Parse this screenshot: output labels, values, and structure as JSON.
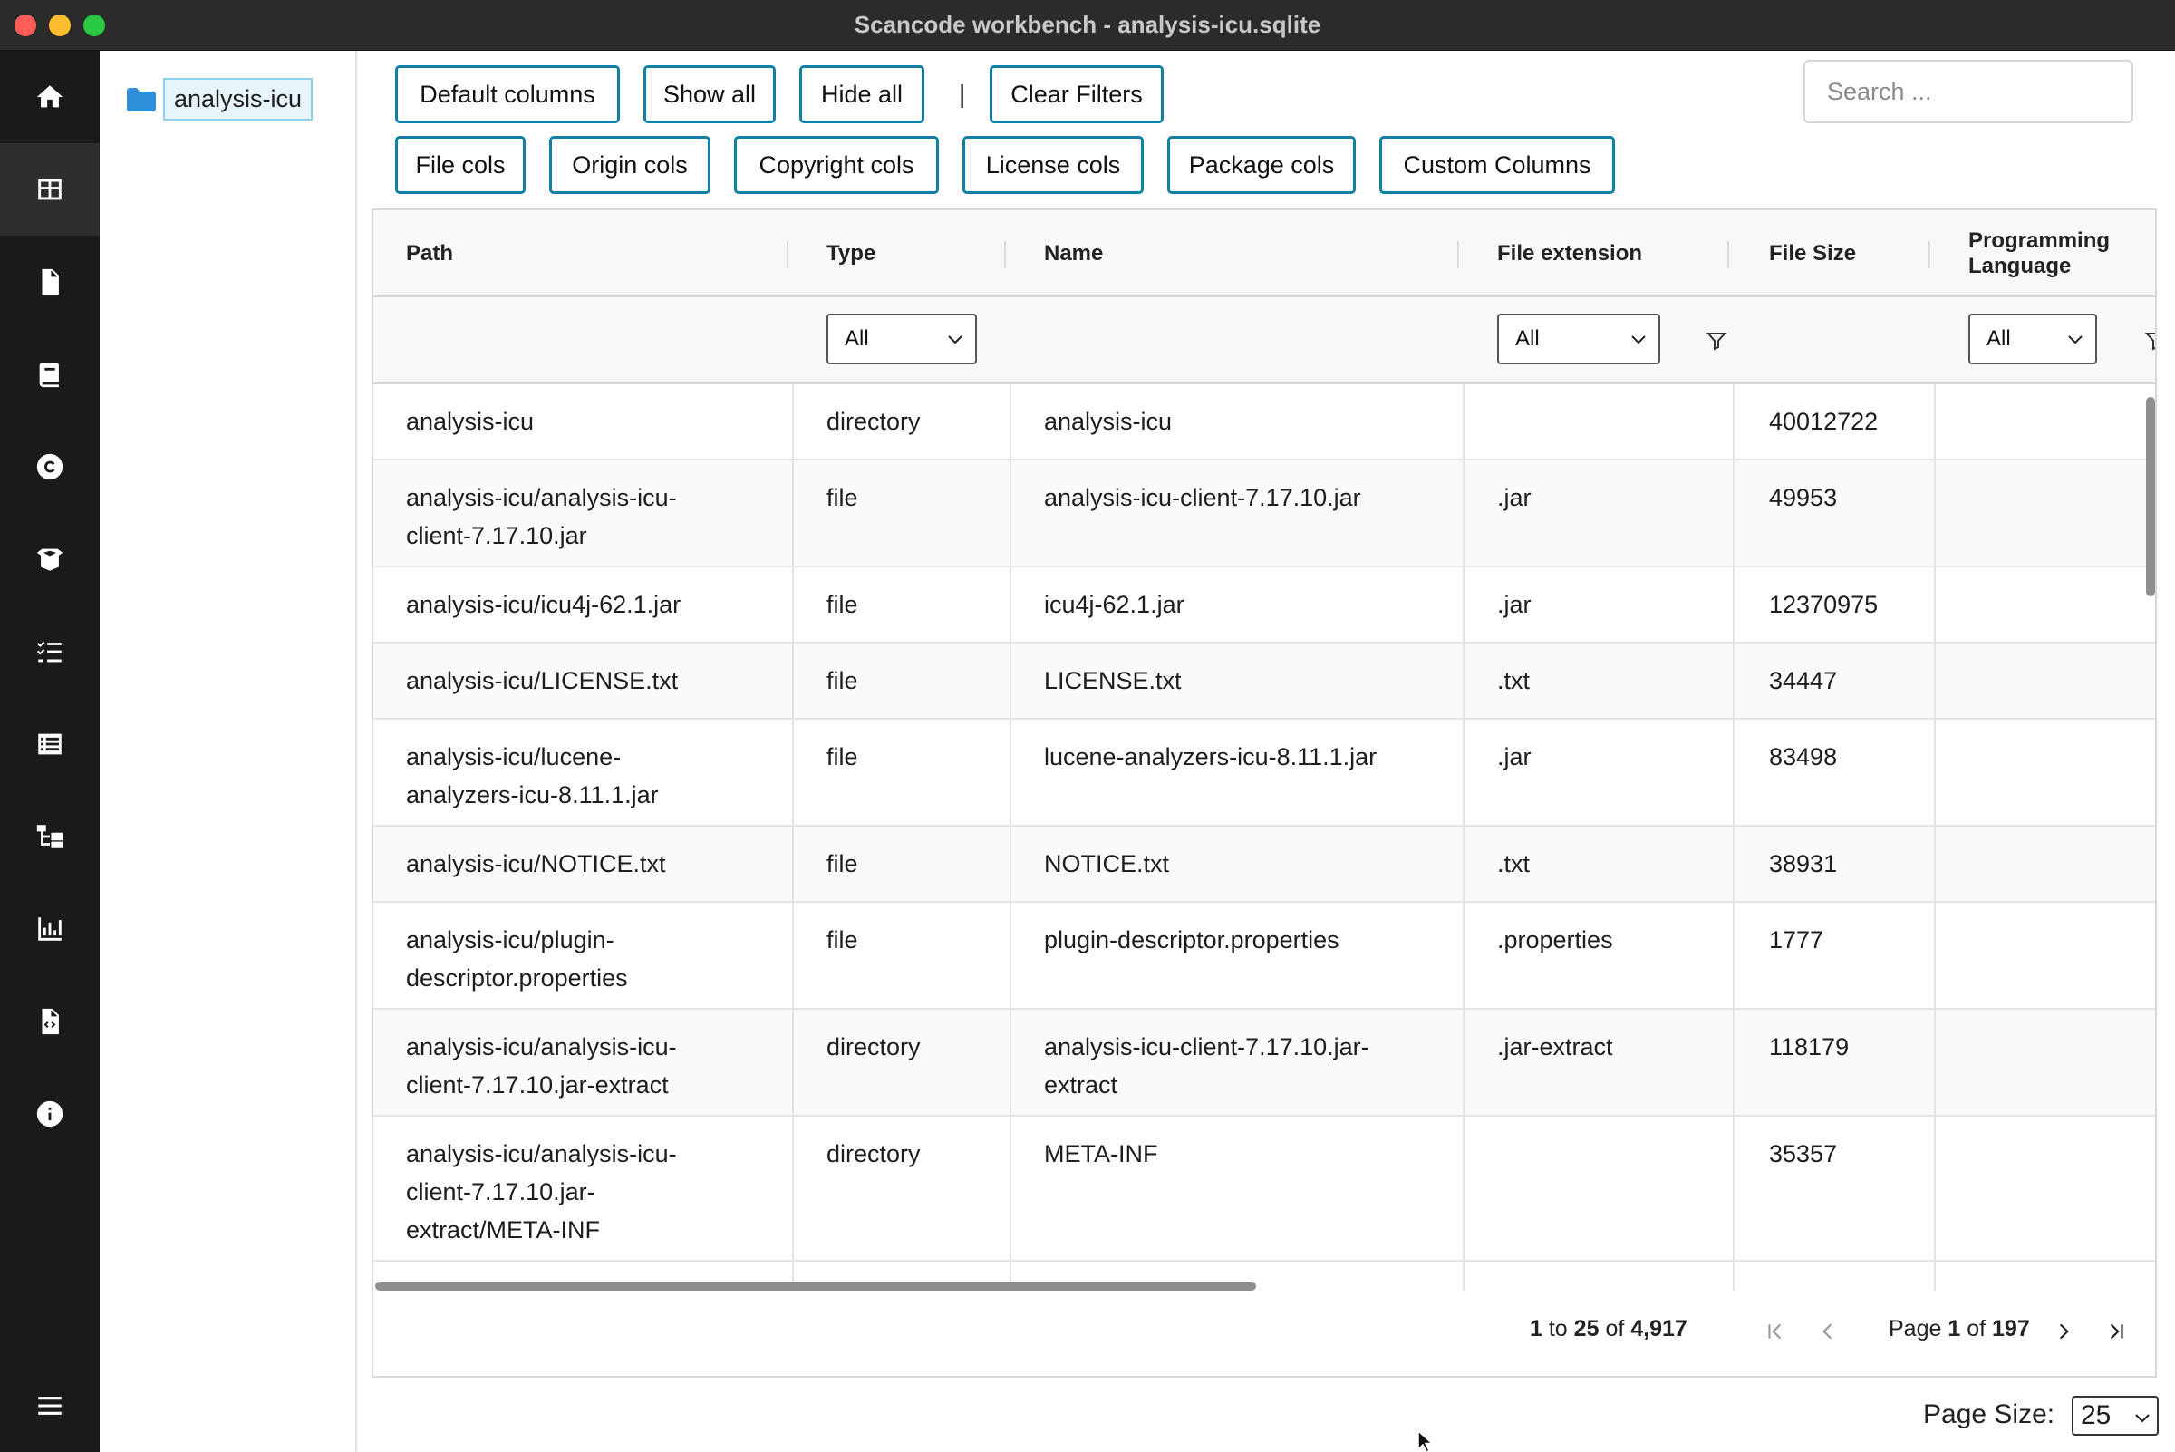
{
  "window": {
    "title": "Scancode workbench - analysis-icu.sqlite"
  },
  "nav": {
    "items": [
      {
        "name": "home-icon",
        "active": false
      },
      {
        "name": "table-view-icon",
        "active": true
      },
      {
        "name": "file-info-icon",
        "active": false
      },
      {
        "name": "license-info-icon",
        "active": false
      },
      {
        "name": "copyright-icon",
        "active": false
      },
      {
        "name": "package-icon",
        "active": false
      },
      {
        "name": "dependency-list-icon",
        "active": false
      },
      {
        "name": "license-detections-icon",
        "active": false
      },
      {
        "name": "tree-view-icon",
        "active": false
      },
      {
        "name": "chart-summary-icon",
        "active": false
      },
      {
        "name": "scan-info-icon",
        "active": false
      },
      {
        "name": "about-info-icon",
        "active": false
      }
    ],
    "menu_icon": "hamburger-menu-icon"
  },
  "tree": {
    "root_label": "analysis-icu"
  },
  "toolbar": {
    "default_columns": "Default columns",
    "show_all": "Show all",
    "hide_all": "Hide all",
    "separator": "|",
    "clear_filters": "Clear Filters",
    "file_cols": "File cols",
    "origin_cols": "Origin cols",
    "copyright_cols": "Copyright cols",
    "license_cols": "License cols",
    "package_cols": "Package cols",
    "custom_columns": "Custom Columns",
    "search_placeholder": "Search ..."
  },
  "table": {
    "headers": {
      "path": "Path",
      "type": "Type",
      "name": "Name",
      "file_extension": "File extension",
      "file_size": "File Size",
      "programming_language_1": "Programming",
      "programming_language_2": "Language"
    },
    "filters": {
      "type": "All",
      "file_extension": "All",
      "programming_language": "All"
    },
    "rows": [
      {
        "path": [
          "analysis-icu"
        ],
        "type": "directory",
        "name": [
          "analysis-icu"
        ],
        "ext": "",
        "size": "40012722"
      },
      {
        "path": [
          "analysis-icu/analysis-icu-",
          "client-7.17.10.jar"
        ],
        "type": "file",
        "name": [
          "analysis-icu-client-7.17.10.jar"
        ],
        "ext": ".jar",
        "size": "49953"
      },
      {
        "path": [
          "analysis-icu/icu4j-62.1.jar"
        ],
        "type": "file",
        "name": [
          "icu4j-62.1.jar"
        ],
        "ext": ".jar",
        "size": "12370975"
      },
      {
        "path": [
          "analysis-icu/LICENSE.txt"
        ],
        "type": "file",
        "name": [
          "LICENSE.txt"
        ],
        "ext": ".txt",
        "size": "34447"
      },
      {
        "path": [
          "analysis-icu/lucene-",
          "analyzers-icu-8.11.1.jar"
        ],
        "type": "file",
        "name": [
          "lucene-analyzers-icu-8.11.1.jar"
        ],
        "ext": ".jar",
        "size": "83498"
      },
      {
        "path": [
          "analysis-icu/NOTICE.txt"
        ],
        "type": "file",
        "name": [
          "NOTICE.txt"
        ],
        "ext": ".txt",
        "size": "38931"
      },
      {
        "path": [
          "analysis-icu/plugin-",
          "descriptor.properties"
        ],
        "type": "file",
        "name": [
          "plugin-descriptor.properties"
        ],
        "ext": ".properties",
        "size": "1777"
      },
      {
        "path": [
          "analysis-icu/analysis-icu-",
          "client-7.17.10.jar-extract"
        ],
        "type": "directory",
        "name": [
          "analysis-icu-client-7.17.10.jar-",
          "extract"
        ],
        "ext": ".jar-extract",
        "size": "118179"
      },
      {
        "path": [
          "analysis-icu/analysis-icu-",
          "client-7.17.10.jar-",
          "extract/META-INF"
        ],
        "type": "directory",
        "name": [
          "META-INF"
        ],
        "ext": "",
        "size": "35357"
      }
    ]
  },
  "pagination": {
    "from": "1",
    "to_word": "to",
    "to": "25",
    "of_word": "of",
    "total": "4,917",
    "page_word": "Page",
    "page": "1",
    "page_count": "197",
    "page_size_label": "Page Size:",
    "page_size": "25"
  }
}
